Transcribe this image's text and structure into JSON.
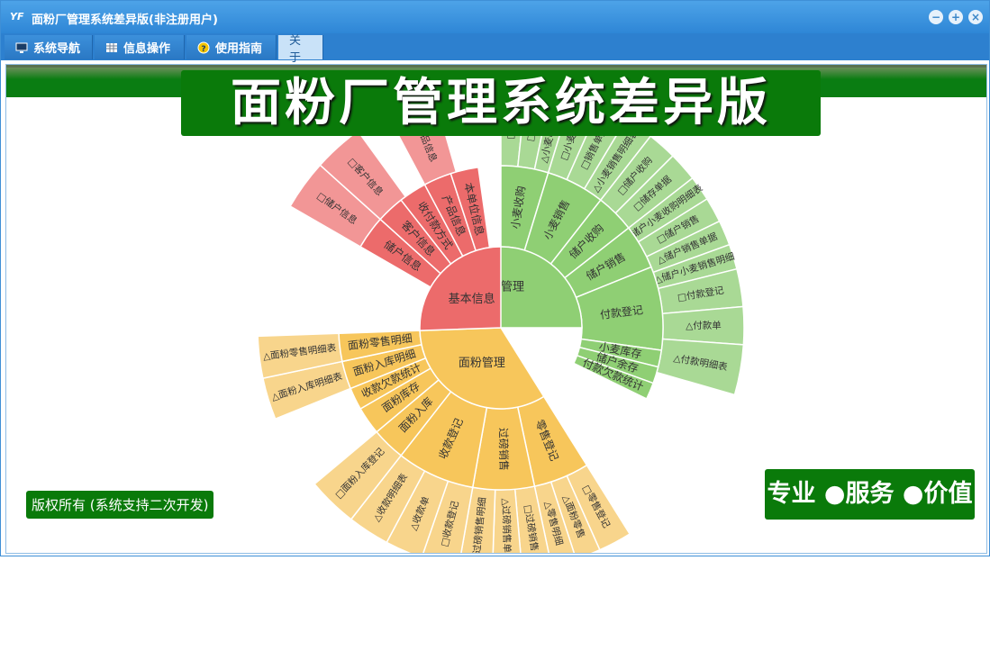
{
  "window": {
    "title": "面粉厂管理系统差异版(非注册用户)",
    "logo": "YF",
    "controls": {
      "minimize": "−",
      "maximize": "+",
      "close": "×"
    }
  },
  "menu": {
    "items": [
      {
        "label": "系统导航",
        "icon": "monitor-icon"
      },
      {
        "label": "信息操作",
        "icon": "grid-icon"
      },
      {
        "label": "使用指南",
        "icon": "help-icon"
      },
      {
        "label": "关于",
        "icon": ""
      }
    ],
    "active_index": 3
  },
  "banner": {
    "title": "面粉厂管理系统差异版"
  },
  "footer": {
    "copyright": "版权所有 (系统支持二次开发)",
    "slogan": "专业 ●服务 ●价值"
  },
  "colors": {
    "green_dark": "#0a7a0a",
    "ring_green": [
      "#8fcf74",
      "#a9d995"
    ],
    "ring_orange": [
      "#f7c65b",
      "#f8d58c"
    ],
    "ring_red": [
      "#ec6b6b",
      "#f29696"
    ]
  },
  "sunburst": {
    "root": [
      {
        "name": "小麦管理",
        "start": -90,
        "end": 90,
        "color": "#8fcf74",
        "outer_color": "#a9d995"
      },
      {
        "name": "面粉管理",
        "start": 148,
        "end": 268,
        "color": "#f7c65b",
        "outer_color": "#f8d58c"
      },
      {
        "name": "基本信息",
        "start": 268,
        "end": 360,
        "color": "#ec6b6b",
        "outer_color": "#f29696"
      }
    ],
    "ring2": [
      {
        "name": "小麦收购",
        "start": 0,
        "end": 17,
        "root": 0
      },
      {
        "name": "小麦销售",
        "start": 17,
        "end": 38,
        "root": 0
      },
      {
        "name": "储户收购",
        "start": 38,
        "end": 52,
        "root": 0
      },
      {
        "name": "储户销售",
        "start": 52,
        "end": 68,
        "root": 0
      },
      {
        "name": "付款登记",
        "start": 68,
        "end": 98,
        "root": 0
      },
      {
        "name": "小麦库存",
        "start": 98,
        "end": 104,
        "root": 0
      },
      {
        "name": "储户余存",
        "start": 104,
        "end": 110,
        "root": 0
      },
      {
        "name": "付款欠款统计",
        "start": 110,
        "end": 116,
        "root": 0
      },
      {
        "name": "零售登记",
        "start": 148,
        "end": 168,
        "root": 1
      },
      {
        "name": "过磅销售",
        "start": 168,
        "end": 190,
        "root": 1
      },
      {
        "name": "收款登记",
        "start": 190,
        "end": 218,
        "root": 1
      },
      {
        "name": "面粉入库",
        "start": 218,
        "end": 230,
        "root": 1
      },
      {
        "name": "面粉库存",
        "start": 230,
        "end": 240,
        "root": 1
      },
      {
        "name": "收款欠款统计",
        "start": 240,
        "end": 248,
        "root": 1
      },
      {
        "name": "面粉入库明细",
        "start": 248,
        "end": 258,
        "root": 1
      },
      {
        "name": "面粉零售明细",
        "start": 258,
        "end": 268,
        "root": 1
      },
      {
        "name": "储户信息",
        "start": 300,
        "end": 312,
        "root": 2
      },
      {
        "name": "客户信息",
        "start": 312,
        "end": 322,
        "root": 2
      },
      {
        "name": "收付款方式",
        "start": 322,
        "end": 332,
        "root": 2
      },
      {
        "name": "产品信息",
        "start": 332,
        "end": 342,
        "root": 2
      },
      {
        "name": "本单位信息",
        "start": 342,
        "end": 352,
        "root": 2
      }
    ],
    "ring3": [
      {
        "name": "□小麦",
        "start": 0,
        "end": 6
      },
      {
        "name": "□收购",
        "start": 6,
        "end": 12
      },
      {
        "name": "△小麦收购明细",
        "start": 12,
        "end": 17
      },
      {
        "name": "□小麦销售",
        "start": 17,
        "end": 24
      },
      {
        "name": "□销售单据",
        "start": 24,
        "end": 31
      },
      {
        "name": "△小麦销售明细表",
        "start": 31,
        "end": 38
      },
      {
        "name": "□储户收购",
        "start": 38,
        "end": 45
      },
      {
        "name": "□储存单据",
        "start": 45,
        "end": 52
      },
      {
        "name": "储户小麦收购明细表",
        "start": 52,
        "end": 58
      },
      {
        "name": "□储户销售",
        "start": 58,
        "end": 64
      },
      {
        "name": "△储户销售单据",
        "start": 64,
        "end": 70
      },
      {
        "name": "△储户小麦销售明细",
        "start": 70,
        "end": 76
      },
      {
        "name": "□付款登记",
        "start": 76,
        "end": 85
      },
      {
        "name": "△付款单",
        "start": 85,
        "end": 94
      },
      {
        "name": "△付款明细表",
        "start": 94,
        "end": 106
      },
      {
        "name": "□零售登记",
        "start": 148,
        "end": 156
      },
      {
        "name": "△面粉零售",
        "start": 156,
        "end": 162
      },
      {
        "name": "△零售明细",
        "start": 162,
        "end": 168
      },
      {
        "name": "□过磅销售",
        "start": 168,
        "end": 175
      },
      {
        "name": "△过磅销售单据",
        "start": 175,
        "end": 182
      },
      {
        "name": "△过磅销售明细",
        "start": 182,
        "end": 190
      },
      {
        "name": "□收款登记",
        "start": 190,
        "end": 199
      },
      {
        "name": "△收款单",
        "start": 199,
        "end": 208
      },
      {
        "name": "△收款明细表",
        "start": 208,
        "end": 218
      },
      {
        "name": "□面粉入库登记",
        "start": 218,
        "end": 230
      },
      {
        "name": "△面粉入库明细表",
        "start": 248,
        "end": 258
      },
      {
        "name": "△面粉零售明细表",
        "start": 258,
        "end": 268
      },
      {
        "name": "□储户信息",
        "start": 300,
        "end": 312
      },
      {
        "name": "□客户信息",
        "start": 312,
        "end": 324
      },
      {
        "name": "□产品信息",
        "start": 332,
        "end": 344
      }
    ]
  }
}
